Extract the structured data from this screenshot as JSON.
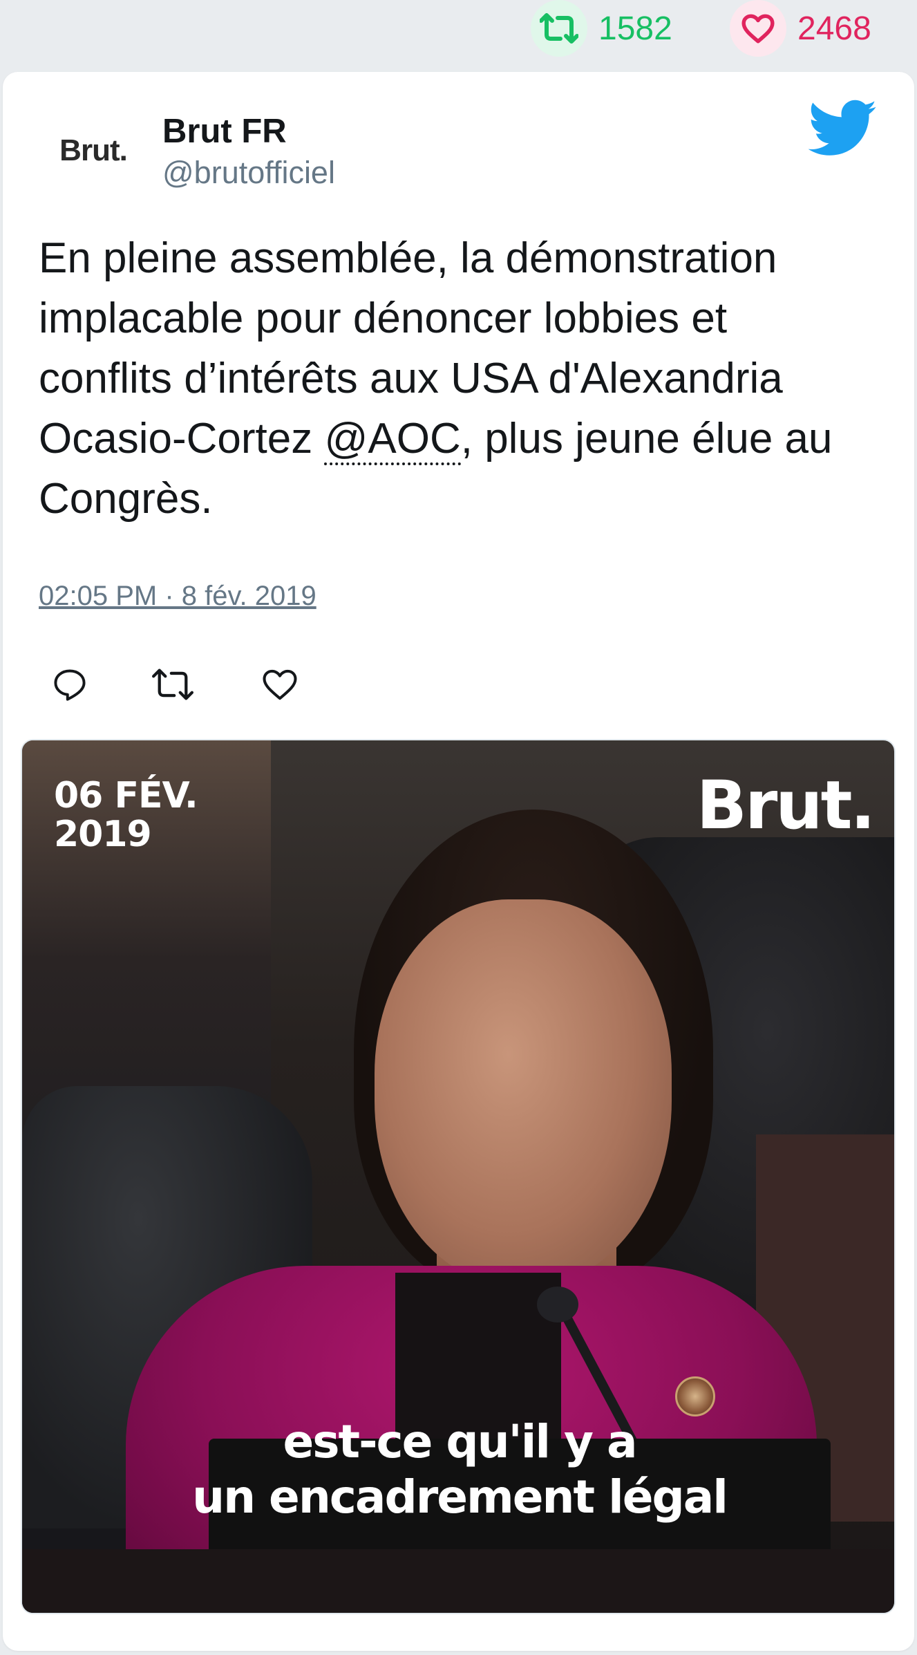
{
  "top_stats": {
    "retweet_count": "1582",
    "like_count": "2468",
    "retweet_color": "#17bf63",
    "like_color": "#e0245e"
  },
  "tweet": {
    "avatar_text": "Brut.",
    "author_name": "Brut FR",
    "author_handle": "@brutofficiel",
    "text_before_mention": "En pleine assemblée, la démonstration implacable pour dénoncer lobbies et conflits d’intérêts aux USA d'Alexandria Ocasio-Cortez ",
    "mention": "@AOC",
    "text_after_mention": ", plus jeune élue au Congrès.",
    "timestamp": "02:05 PM · 8 fév. 2019",
    "icons": [
      "twitter-bird-icon",
      "reply-icon",
      "retweet-icon",
      "like-icon"
    ],
    "accent_color": "#1da1f2"
  },
  "media": {
    "date_line1": "06 FÉV.",
    "date_line2": "2019",
    "logo": "Brut.",
    "subtitle_line1": "est-ce qu'il y a",
    "subtitle_line2": "un encadrement légal"
  }
}
